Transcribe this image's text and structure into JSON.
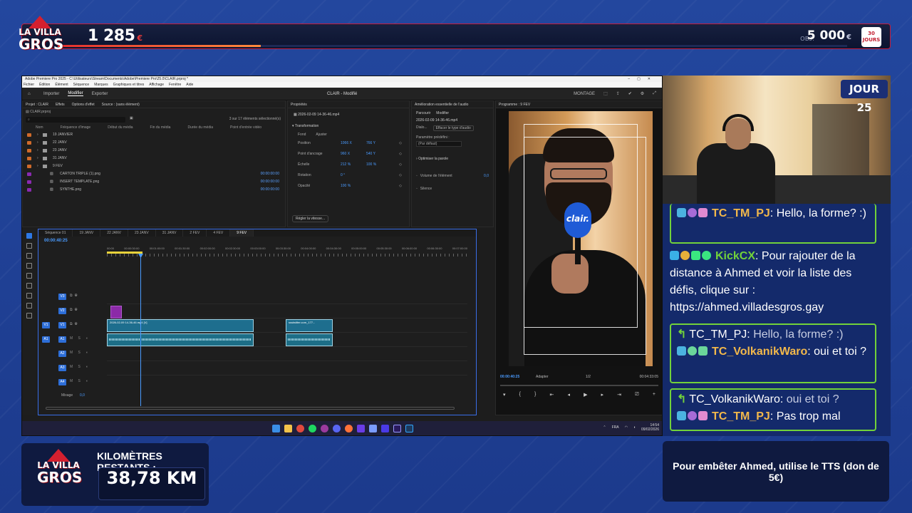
{
  "overlay": {
    "donation_amount": "1 285",
    "donation_currency": "€",
    "goal_label": "OBJ.",
    "goal_amount": "5 000",
    "goal_currency": "€",
    "goal_progress": 0.257,
    "goal_badge": "30 JOURS",
    "logo_line1": "LA VILLA",
    "logo_line2": "GROS",
    "day_badge": "JOUR 25",
    "km_label": "KILOMÈTRES RESTANTS :",
    "km_value": "38,78 KM",
    "tts_text": "Pour embêter Ahmed, utilise le TTS (don de 5€)"
  },
  "premiere": {
    "window_title": "Adobe Premiere Pro 2025 - C:\\Utilisateurs\\Stream\\Documents\\Adobe\\Premiere Pro\\25.0\\CLAIR.prproj *",
    "menu": [
      "Fichier",
      "Édition",
      "Élément",
      "Séquence",
      "Marques",
      "Graphiques et titres",
      "Affichage",
      "Fenêtre",
      "Aide"
    ],
    "workspace_tabs": [
      "Importer",
      "Modifier",
      "Exporter"
    ],
    "active_workspace": "Modifier",
    "doc_title": "CLAIR - Modifié",
    "montage_label": "MONTAGE",
    "project": {
      "tabs": [
        "Projet : CLAIR",
        "Effets",
        "Options d'effet",
        "Source : (sans élément)"
      ],
      "file": "CLAIR.prproj",
      "count": "3 sur 17 éléments sélectionné(s)",
      "columns": [
        "Nom",
        "Fréquence d'image",
        "Début du média",
        "Fin du média",
        "Durée du média",
        "Point d'entrée vidéo"
      ],
      "folders": [
        {
          "name": "19 JANVIER",
          "color": "#d06a2a"
        },
        {
          "name": "22 JANV",
          "color": "#d06a2a"
        },
        {
          "name": "23 JANV",
          "color": "#d06a2a"
        },
        {
          "name": "31 JANV",
          "color": "#d06a2a"
        },
        {
          "name": "9 FEV",
          "color": "#d06a2a"
        }
      ],
      "files": [
        {
          "name": "CARTON TRIPLE (1).png",
          "tc": "00:00:00:00",
          "color": "#8a2ab0"
        },
        {
          "name": "INSERT TEMPLATE.png",
          "tc": "00:00:00:00",
          "color": "#8a2ab0"
        },
        {
          "name": "SYNTHE.png",
          "tc": "00:00:00:00",
          "color": "#8a2ab0"
        }
      ]
    },
    "properties": {
      "title": "Propriétés",
      "clip": "2026-02-09 14-36-46.mp4",
      "section": "Transformation",
      "fond": "Fond",
      "ajuster": "Ajuster",
      "rows": [
        {
          "label": "Position",
          "v1": "1066 X",
          "v2": "766 Y"
        },
        {
          "label": "Point d'ancrage",
          "v1": "960 X",
          "v2": "540 Y"
        },
        {
          "label": "Échelle",
          "v1": "212 %",
          "v2": "100 %"
        },
        {
          "label": "Rotation",
          "v1": "0 °",
          "v2": ""
        },
        {
          "label": "Opacité",
          "v1": "100 %",
          "v2": ""
        }
      ],
      "speed_btn": "Régler la vitesse..."
    },
    "audio": {
      "title": "Amélioration essentielle de l'audio",
      "tabs": [
        "Parcourir",
        "Modifier"
      ],
      "clip": "2026-02-09 14-36-46.mp4",
      "dialog": "Dialo...",
      "change_type": "Effacer le type d'audio",
      "preset_label": "Paramètre prédéfini :",
      "preset_value": "(Par défaut)",
      "optimize": "Optimiser la parole",
      "volume": "Volume de l'élément",
      "volume_value": "0,0",
      "silence": "Silence"
    },
    "program": {
      "title": "Programme : 9 FEV",
      "mic_text": "clair.",
      "timecode": "00:00:40:25",
      "fit": "Adapter",
      "ratio": "1/2",
      "duration": "00:04:33:05"
    },
    "timeline": {
      "seq_tabs": [
        "Séquence 01",
        "19 JANV",
        "22 JANV",
        "23 JANV",
        "31 JANV",
        "2 FEV",
        "4 FEV",
        "9 FEV"
      ],
      "active_seq": "9 FEV",
      "timecode": "00:00:40:25",
      "ruler": [
        "00:00",
        "00:00:30:00",
        "00:01:00:00",
        "00:01:30:00",
        "00:02:00:00",
        "00:02:30:00",
        "00:03:00:00",
        "00:03:30:00",
        "00:04:00:00",
        "00:04:30:00",
        "00:05:00:00",
        "00:05:30:00",
        "00:06:00:00",
        "00:06:30:00",
        "00:07:00:00"
      ],
      "tracks": [
        "V3",
        "V2",
        "V1",
        "A1",
        "A2",
        "A3",
        "A4"
      ],
      "mix_label": "Mixage",
      "mix_value": "0,0",
      "clip_main": "2026-02-09 14-36-46.mp4 [V]",
      "clip_second": "ssstwitter.com_177..."
    },
    "taskbar": {
      "lang": "FRA",
      "time": "14:54",
      "date": "09/02/2026"
    }
  },
  "chat": [
    {
      "user": "TC_TM_PJ",
      "user_color": "#f2b84b",
      "text": "Hello, la forme? :)",
      "boxed": true
    },
    {
      "user": "KickCX",
      "user_color": "#72d23a",
      "text": "Pour rajouter de la distance à Ahmed et voir la liste des défis, clique sur : https://ahmed.villadesgros.gay",
      "boxed": false
    },
    {
      "reply_user": "TC_TM_PJ:",
      "reply_text": "Hello, la forme? :)",
      "user": "TC_VolkanikWaro",
      "user_color": "#f2b84b",
      "text": "oui et toi ?",
      "boxed": true
    },
    {
      "reply_user": "TC_VolkanikWaro:",
      "reply_text": "oui et toi ?",
      "user": "TC_TM_PJ",
      "user_color": "#f2b84b",
      "text": "Pas trop mal",
      "boxed": true
    }
  ]
}
